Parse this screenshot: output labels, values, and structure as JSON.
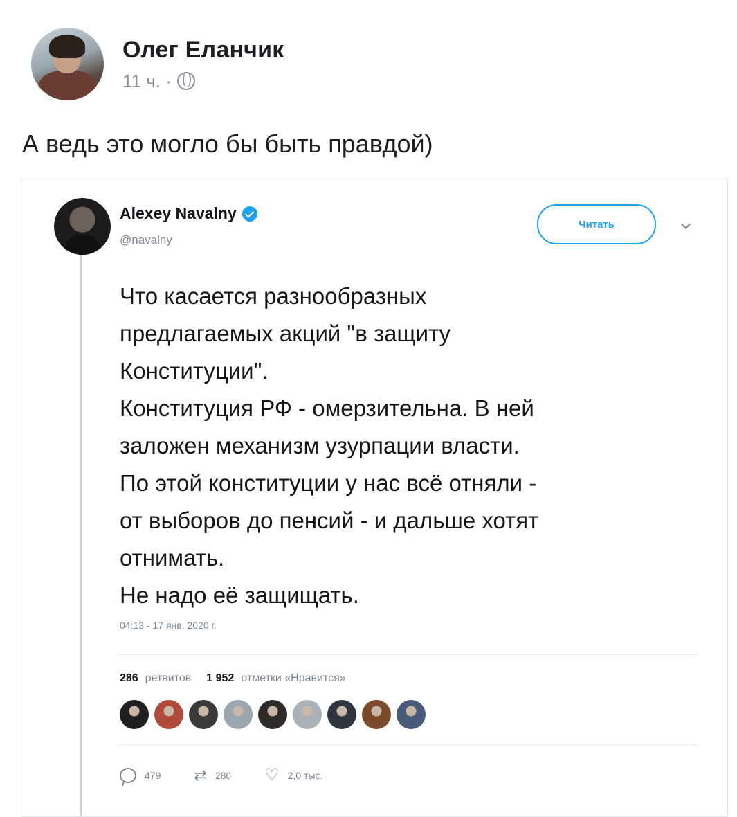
{
  "post": {
    "author": "Олег Еланчик",
    "time": "11 ч. ·",
    "text": "А ведь это могло бы быть правдой)"
  },
  "tweet": {
    "name": "Alexey Navalny",
    "handle": "@navalny",
    "follow_label": "Читать",
    "lines": [
      "Что касается разнообразных",
      "предлагаемых акций \"в защиту",
      "Конституции\".",
      "Конституция РФ - омерзительна. В ней",
      "заложен механизм узурпации власти.",
      "По этой конституции у нас всё отняли -",
      "от выборов до пенсий - и дальше хотят",
      "отнимать.",
      "Не надо её защищать."
    ],
    "timestamp": "04:13 - 17 янв. 2020 г.",
    "retweets_count": "286",
    "retweets_label": "ретвитов",
    "likes_count": "1 952",
    "likes_label": "отметки «Нравится»",
    "liker_colors": [
      "#1f1f1f",
      "#b04a3a",
      "#3a3a3a",
      "#9aa5ae",
      "#2d2a28",
      "#a9b2b9",
      "#2f3540",
      "#7a4a2a",
      "#4a5a7a"
    ],
    "actions": {
      "replies": "479",
      "retweets": "286",
      "likes": "2,0 тыс."
    },
    "accent_color": "#1da1f2"
  }
}
